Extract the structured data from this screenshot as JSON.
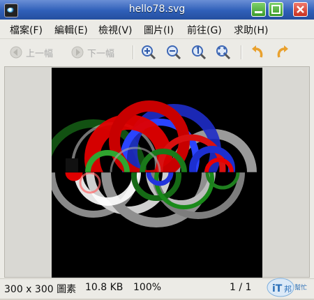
{
  "window": {
    "title": "hello78.svg"
  },
  "menu": {
    "items": [
      "檔案(F)",
      "編輯(E)",
      "檢視(V)",
      "圖片(I)",
      "前往(G)",
      "求助(H)"
    ]
  },
  "toolbar": {
    "prev_label": "上一幅",
    "next_label": "下一幅"
  },
  "status": {
    "dimensions": "300 x 300 圖素",
    "file_size": "10.8 KB",
    "zoom": "100%",
    "page": "1 / 1"
  },
  "watermark": {
    "text_main": "iT",
    "text_sub": "邦",
    "text_side": "幫忙"
  },
  "colors": {
    "canvas_bg": "#000000",
    "title_bar": "#2f5fb8",
    "rotate_icon": "#f0a030"
  }
}
